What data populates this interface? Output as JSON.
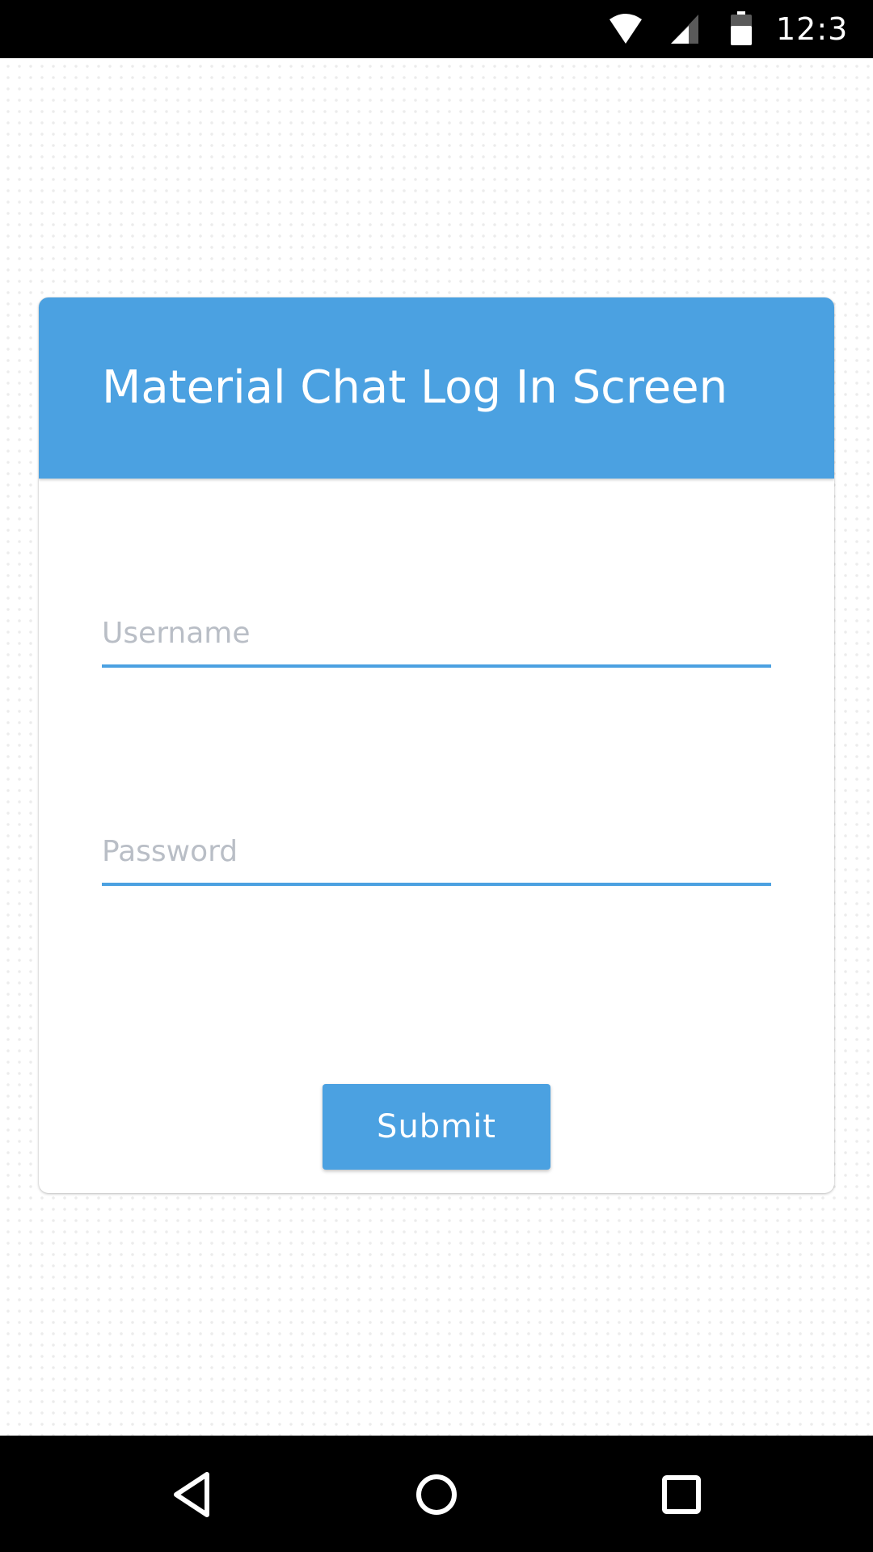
{
  "status_bar": {
    "time": "12:3",
    "icons": [
      "wifi-icon",
      "cell-signal-icon",
      "battery-icon"
    ]
  },
  "card": {
    "title": "Material Chat Log In Screen",
    "username": {
      "placeholder": "Username",
      "value": ""
    },
    "password": {
      "placeholder": "Password",
      "value": ""
    },
    "submit_label": "Submit"
  },
  "nav_bar": {
    "icons": [
      "back-icon",
      "home-icon",
      "recents-icon"
    ]
  },
  "colors": {
    "accent": "#4ba1e1",
    "placeholder": "#b9bec6",
    "system_bars": "#000000",
    "card_background": "#ffffff"
  }
}
